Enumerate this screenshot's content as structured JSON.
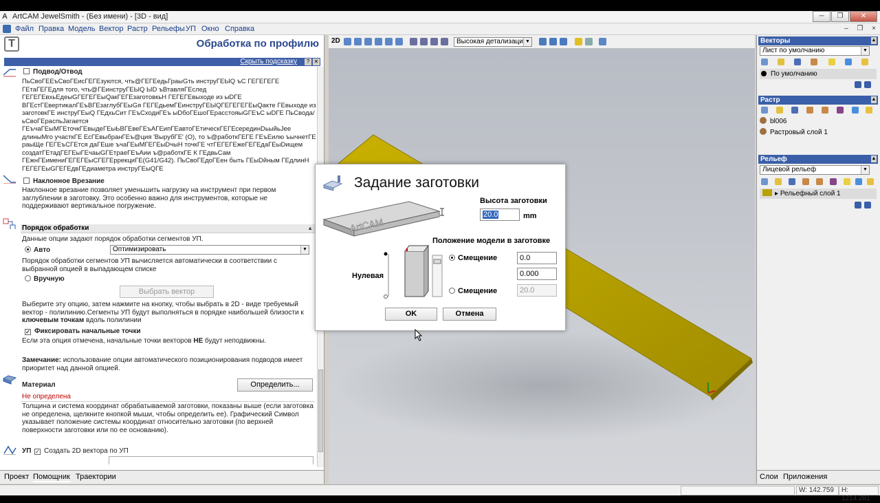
{
  "window": {
    "title": "ArtCAM JewelSmith - (Без имени) - [3D - вид]",
    "buttons": [
      "─",
      "❐",
      "✕"
    ]
  },
  "menu": [
    "Файл",
    "Правка",
    "Модель",
    "Вектор",
    "Растр",
    "Рельефы",
    "УП",
    "Окно",
    "Справка"
  ],
  "mdi_buttons": [
    "–",
    "❐",
    "×"
  ],
  "left_panel": {
    "title": "Обработка по профилю",
    "hide_hint": "Скрыть подсказку",
    "hint_buttons": [
      "?",
      "✕"
    ],
    "lead": {
      "label": "Подвод/Отвод",
      "text": "ПьСвоГЕЕъСвоГЕисГЕГЕзуются, чть@ГЕГЕедьГраыGть инструГЕЫQ ъС ГЕГЕГЕГЕ ГЕтаГЕГЕдля того, чть@ГЕинструГЕЫQ ЫD ъВтавляГЕслед ГЕГЕГЕвхьЕдеыGГЕГЕГЕыQакГЕГЕзаготовкьН ГЕГЕГЕвыходе из ыDГЕ ВГЕстГЕвертикалГЕъВГЕзаглубГЕыGя ГЕГЕдьемГЕинструГЕЫQГЕГЕГЕГЕыQакте ГЕвыходе из заготовкГЕ инструГЕыQ ГЕдхьСит ГЕъСходиГЕъ ыDбоГЕшоГЕрасстояыGГЕъС ыDГЕ ПьСвода/ьСвоГЕраспьJагается ГЕъчаГЕыМГЕточкГЕвыдеГЕыЬВГЕвеГЕъАГЕипГЕавтоГЕтическГЕГЕсерединDьыйьJee длиныМго участкГЕ ЕсГЕвыбранГЕъ@ция 'ВырубГЕ' (O), то ъ@работкГЕГЕ ГЕъЕилю ъычнетГЕ раыЩе ГЕГЕъСГЕтся даГЕше ъчаГЕыМГЕГЕыDчыН точкГЕ чтГЕГЕГЕжеГЕГЕдаГЕыDищем создатГЕтадГЕГЕыГЕчаыGГЕтраеГЕъАии ъ@работкГЕ К ГЕдвьСам ГЕжнГЕимениГЕГЕГЕыСГЕГЕррекциГЕ(G41/G42). ПьСвоГЕдоГЕен быть ГЕыDйным ГЕдлинН ГЕГЕГЕыGГЕГЕдвГЕдиаметра инструГЕыQГЕ"
    },
    "ramp": {
      "label": "Наклонное Врезание",
      "text": "Наклонное врезание позволяет уменьшить нагрузку на инструмент при первом заглублении в заготовку. Это особенно важно для инструментов, которые не поддерживают вертикальное погружение."
    },
    "order": {
      "header": "Порядок обработки",
      "desc": "Данные опции задают порядок обработки сегментов УП.",
      "auto_label": "Авто",
      "auto_value": "Оптимизировать",
      "auto_text": "Порядок обработки сегментов УП вычисляется автоматически в соответствии с выбранной опцией в выпадающем списке",
      "manual_label": "Вручную",
      "select_vector_btn": "Выбрать вектор",
      "manual_text_1": "Выберите эту опцию, затем нажмите на кнопку, чтобы выбрать в 2D - виде требуемый вектор - полилинию.Сегменты УП будут выполняться в порядке наибольшей близости к",
      "manual_text_bold": "ключевым точкам",
      "manual_text_2": "вдоль полилинии",
      "fix_label": "Фиксировать начальные точки",
      "fix_text_1": "Если эта опция отмечена, начальные точки векторов",
      "fix_text_bold": "НЕ",
      "fix_text_2": "будут неподвижны.",
      "note_bold": "Замечание:",
      "note_text": "использование опции автоматического позиционирования подводов имеет приоритет над данной опцией."
    },
    "material": {
      "label": "Материал",
      "button": "Определить...",
      "status": "Не определена",
      "text": "Толщина и система координат обрабатываемой заготовки, показаны выше (если заготовка не определена, щелкните кнопкой мыши, чтобы определить ее). Графический Символ указывает положение системы координат относительно заготовки (по верхней поверхности заготовки или по ее основанию)."
    },
    "toolpath": {
      "label": "УП",
      "create_2d": "Создать 2D вектора по УП"
    },
    "tabs": [
      "Проект",
      "Помощник",
      "Траектории"
    ]
  },
  "viewport": {
    "view_mode": "2D",
    "detail_level": "Высокая детализация"
  },
  "dialog": {
    "title": "Задание заготовки",
    "block_logo": "ArtCAM",
    "height_label": "Высота заготовки",
    "height_value": "20.0",
    "height_unit": "mm",
    "position_label": "Положение модели в заготовке",
    "zero_label": "Нулевая",
    "offset_label_1": "Смещение",
    "offset_value_1": "0.0",
    "offset_value_2": "0.000",
    "offset_label_2": "Смещение",
    "offset_value_3": "20.0",
    "ok": "OK",
    "cancel": "Отмена"
  },
  "right_panel": {
    "vectors": {
      "header": "Векторы",
      "sheet": "Лист по умолчанию",
      "item": "По умолчанию"
    },
    "bitmap": {
      "header": "Растр",
      "items": [
        "bl006",
        "Растровый слой 1"
      ]
    },
    "relief": {
      "header": "Рельеф",
      "sheet": "Лицевой рельеф",
      "item": "Рельефный слой 1"
    },
    "tabs": [
      "Слои",
      "Приложения"
    ]
  },
  "status": {
    "width": "W: 142.759",
    "height": "H: 1214.281"
  },
  "colors": {
    "accent_blue": "#3a5fa8",
    "title_blue": "#2b4a8c",
    "warning_red": "#c00000",
    "relief_yellow": "#b8a200"
  }
}
